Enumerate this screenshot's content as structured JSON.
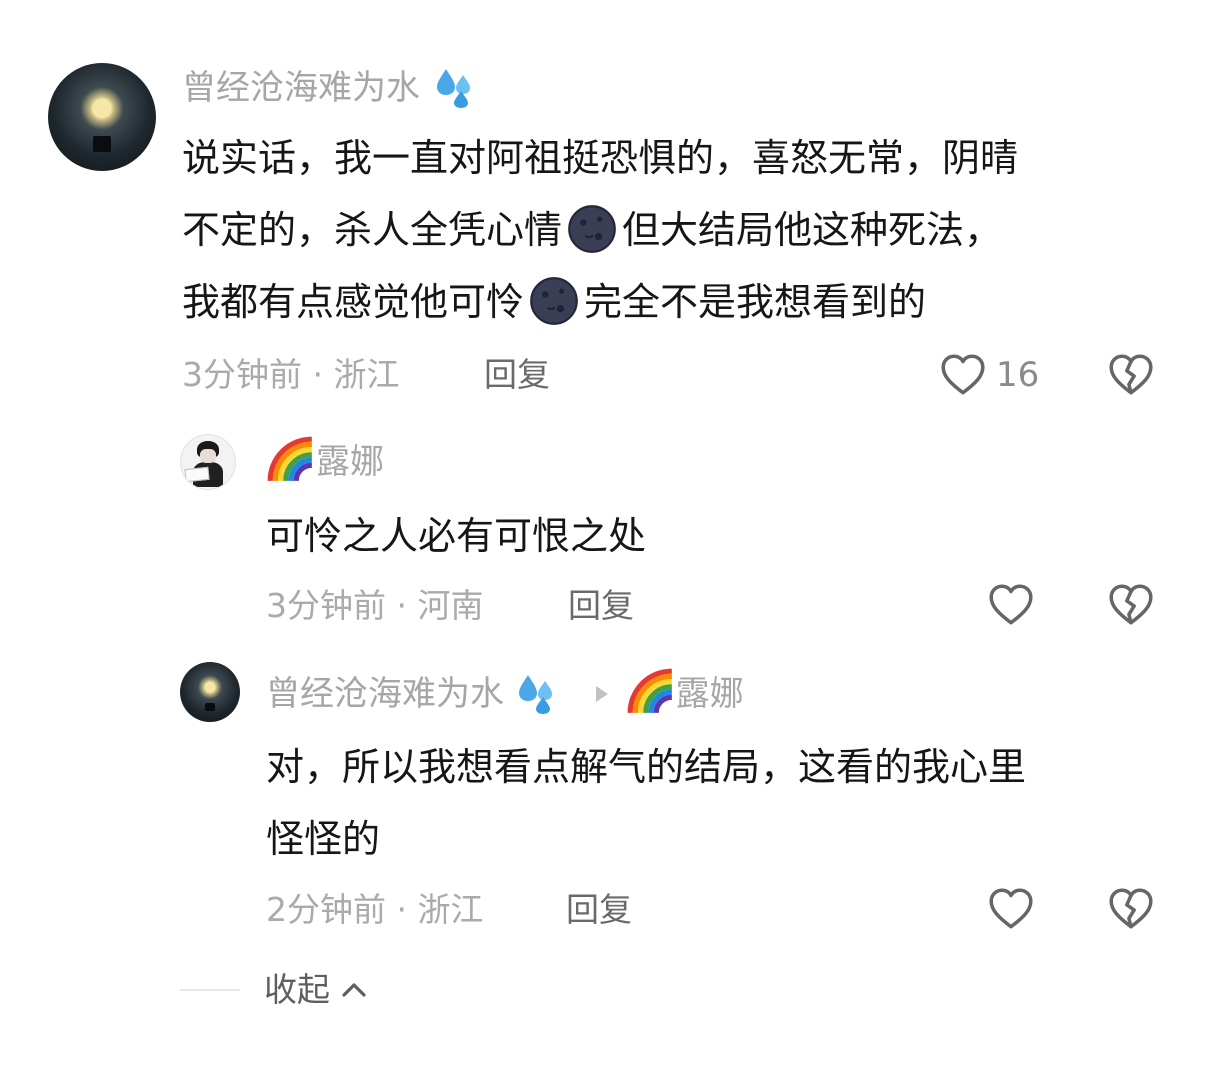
{
  "comment": {
    "username": "曾经沧海难为水",
    "text_lines": [
      "说实话，我一直对阿祖挺恐惧的，喜怒无常，阴晴",
      "不定的，杀人全凭心情",
      "但大结局他这种死法，",
      "我都有点感觉他可怜",
      "完全不是我想看到的"
    ],
    "time": "3分钟前",
    "location": "浙江",
    "reply_label": "回复",
    "like_count": "16"
  },
  "replies": [
    {
      "username": "露娜",
      "text": "可怜之人必有可恨之处",
      "time": "3分钟前",
      "location": "河南",
      "reply_label": "回复"
    },
    {
      "username": "曾经沧海难为水",
      "reply_to": "露娜",
      "text_lines": [
        "对，所以我想看点解气的结局，这看的我心里",
        "怪怪的"
      ],
      "time": "2分钟前",
      "location": "浙江",
      "reply_label": "回复"
    }
  ],
  "collapse_label": "收起",
  "icons": [
    "sweat-droplets-icon",
    "rainbow-icon",
    "new-moon-face-icon",
    "heart-icon",
    "broken-heart-icon",
    "chevron-up-icon",
    "reply-arrow-icon"
  ],
  "colors": {
    "name": "#a6a6a6",
    "text": "#161616",
    "meta": "#aaaaaa",
    "icon": "#666666"
  }
}
